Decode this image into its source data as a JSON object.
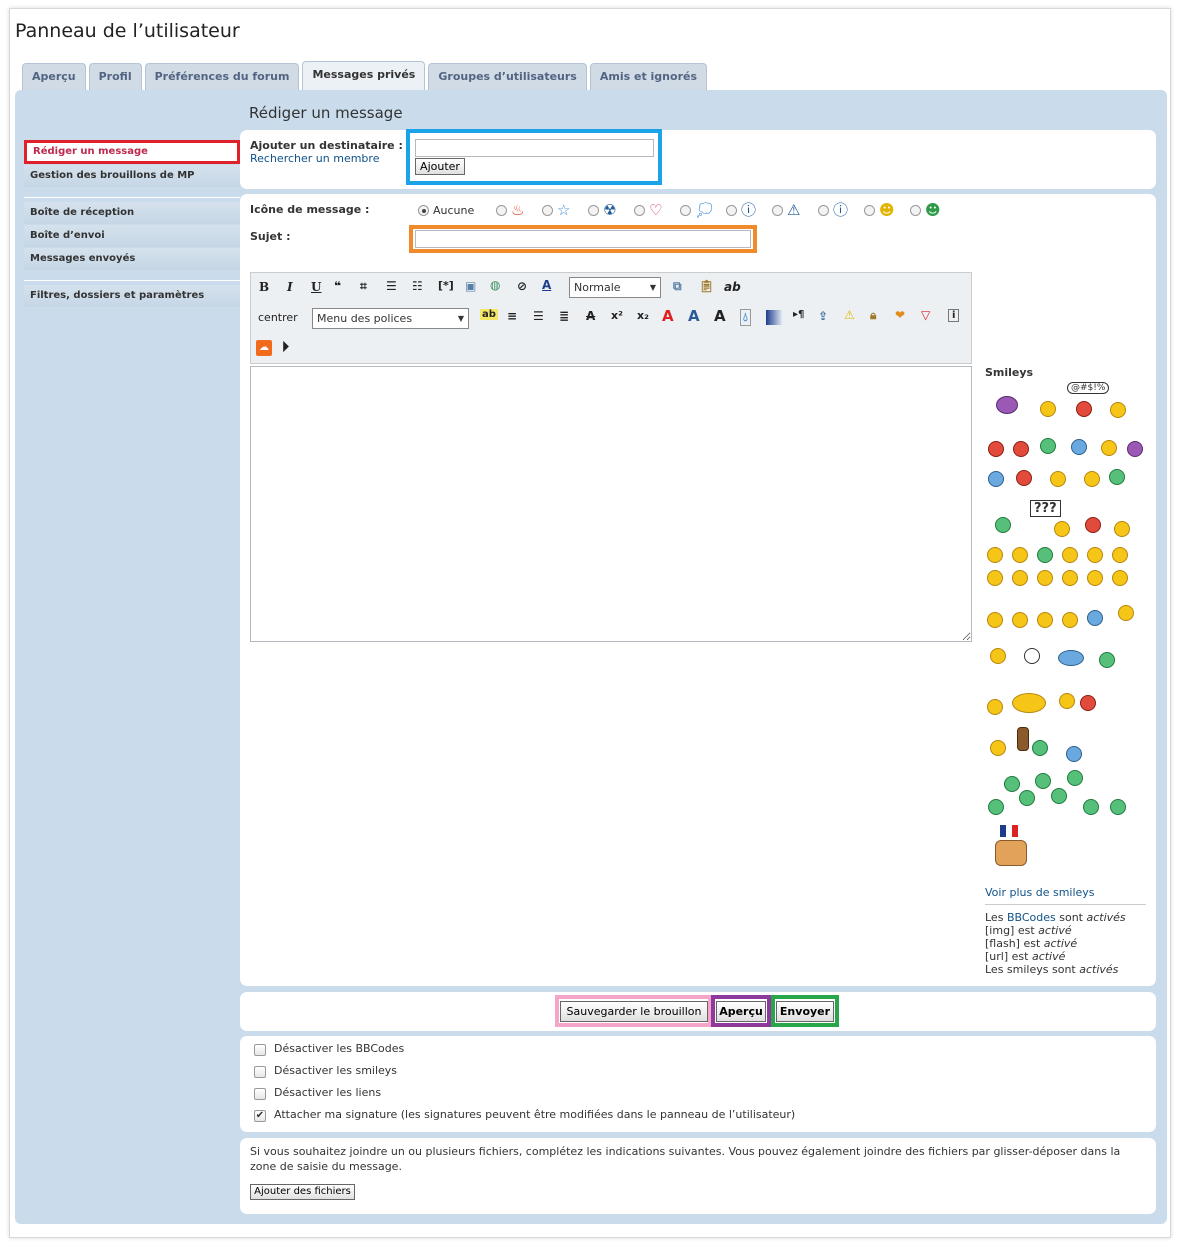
{
  "page_title": "Panneau de l’utilisateur",
  "tabs": [
    {
      "label": "Aperçu",
      "active": false
    },
    {
      "label": "Profil",
      "active": false
    },
    {
      "label": "Préférences du forum",
      "active": false
    },
    {
      "label": "Messages privés",
      "active": true
    },
    {
      "label": "Groupes d’utilisateurs",
      "active": false
    },
    {
      "label": "Amis et ignorés",
      "active": false
    }
  ],
  "sidebar": {
    "group1": [
      "Rédiger un message",
      "Gestion des brouillons de MP"
    ],
    "group2": [
      "Boîte de réception",
      "Boîte d’envoi",
      "Messages envoyés"
    ],
    "group3": [
      "Filtres, dossiers et paramètres"
    ]
  },
  "heading": "Rédiger un message",
  "recipient": {
    "label": "Ajouter un destinataire :",
    "search_link": "Rechercher un membre",
    "value": "",
    "add_button": "Ajouter"
  },
  "message_icon": {
    "label": "Icône de message :",
    "none_label": "Aucune",
    "icons": [
      "fire-icon",
      "star-icon",
      "radioactive-icon",
      "heart-icon",
      "speech-bubble-icon",
      "question-icon",
      "warning-icon",
      "info-icon",
      "wink-smiley-icon",
      "green-smiley-icon"
    ]
  },
  "subject": {
    "label": "Sujet :",
    "value": ""
  },
  "toolbar": {
    "bold": "B",
    "italic": "I",
    "underline": "U",
    "font_size": "Normale",
    "center_label": "centrer",
    "font_menu": "Menu des polices",
    "replace_label": "ab"
  },
  "message_body": "",
  "smileys": {
    "title": "Smileys",
    "grawlix": "@#$!%",
    "sign": "???",
    "more_link": "Voir plus de smileys"
  },
  "status": {
    "bbcode_prefix": "Les ",
    "bbcode_link": "BBCodes",
    "bbcode_mid": " sont ",
    "bbcode_state": "activés",
    "img_text": "[img] est ",
    "img_state": "activé",
    "flash_text": "[flash] est ",
    "flash_state": "activé",
    "url_text": "[url] est ",
    "url_state": "activé",
    "smileys_text": "Les smileys sont ",
    "smileys_state": "activés"
  },
  "actions": {
    "save_draft": "Sauvegarder le brouillon",
    "preview": "Aperçu",
    "send": "Envoyer"
  },
  "options": [
    {
      "label": "Désactiver les BBCodes",
      "checked": false
    },
    {
      "label": "Désactiver les smileys",
      "checked": false
    },
    {
      "label": "Désactiver les liens",
      "checked": false
    },
    {
      "label": "Attacher ma signature (les signatures peuvent être modifiées dans le panneau de l’utilisateur)",
      "checked": true
    }
  ],
  "attachments": {
    "info": "Si vous souhaitez joindre un ou plusieurs fichiers, complétez les indications suivantes. Vous pouvez également joindre des fichiers par glisser-déposer dans la zone de saisie du message.",
    "button": "Ajouter des fichiers"
  },
  "colors": {
    "panel_bg": "#cadceb",
    "link": "#105289",
    "current_nav": "#bc2a4d",
    "highlight_red": "#e0202a",
    "highlight_blue": "#1aa3e8",
    "highlight_orange": "#f08a2a",
    "highlight_pink": "#f4a6c8",
    "highlight_purple": "#8e3a9d",
    "highlight_green": "#27a64a"
  }
}
